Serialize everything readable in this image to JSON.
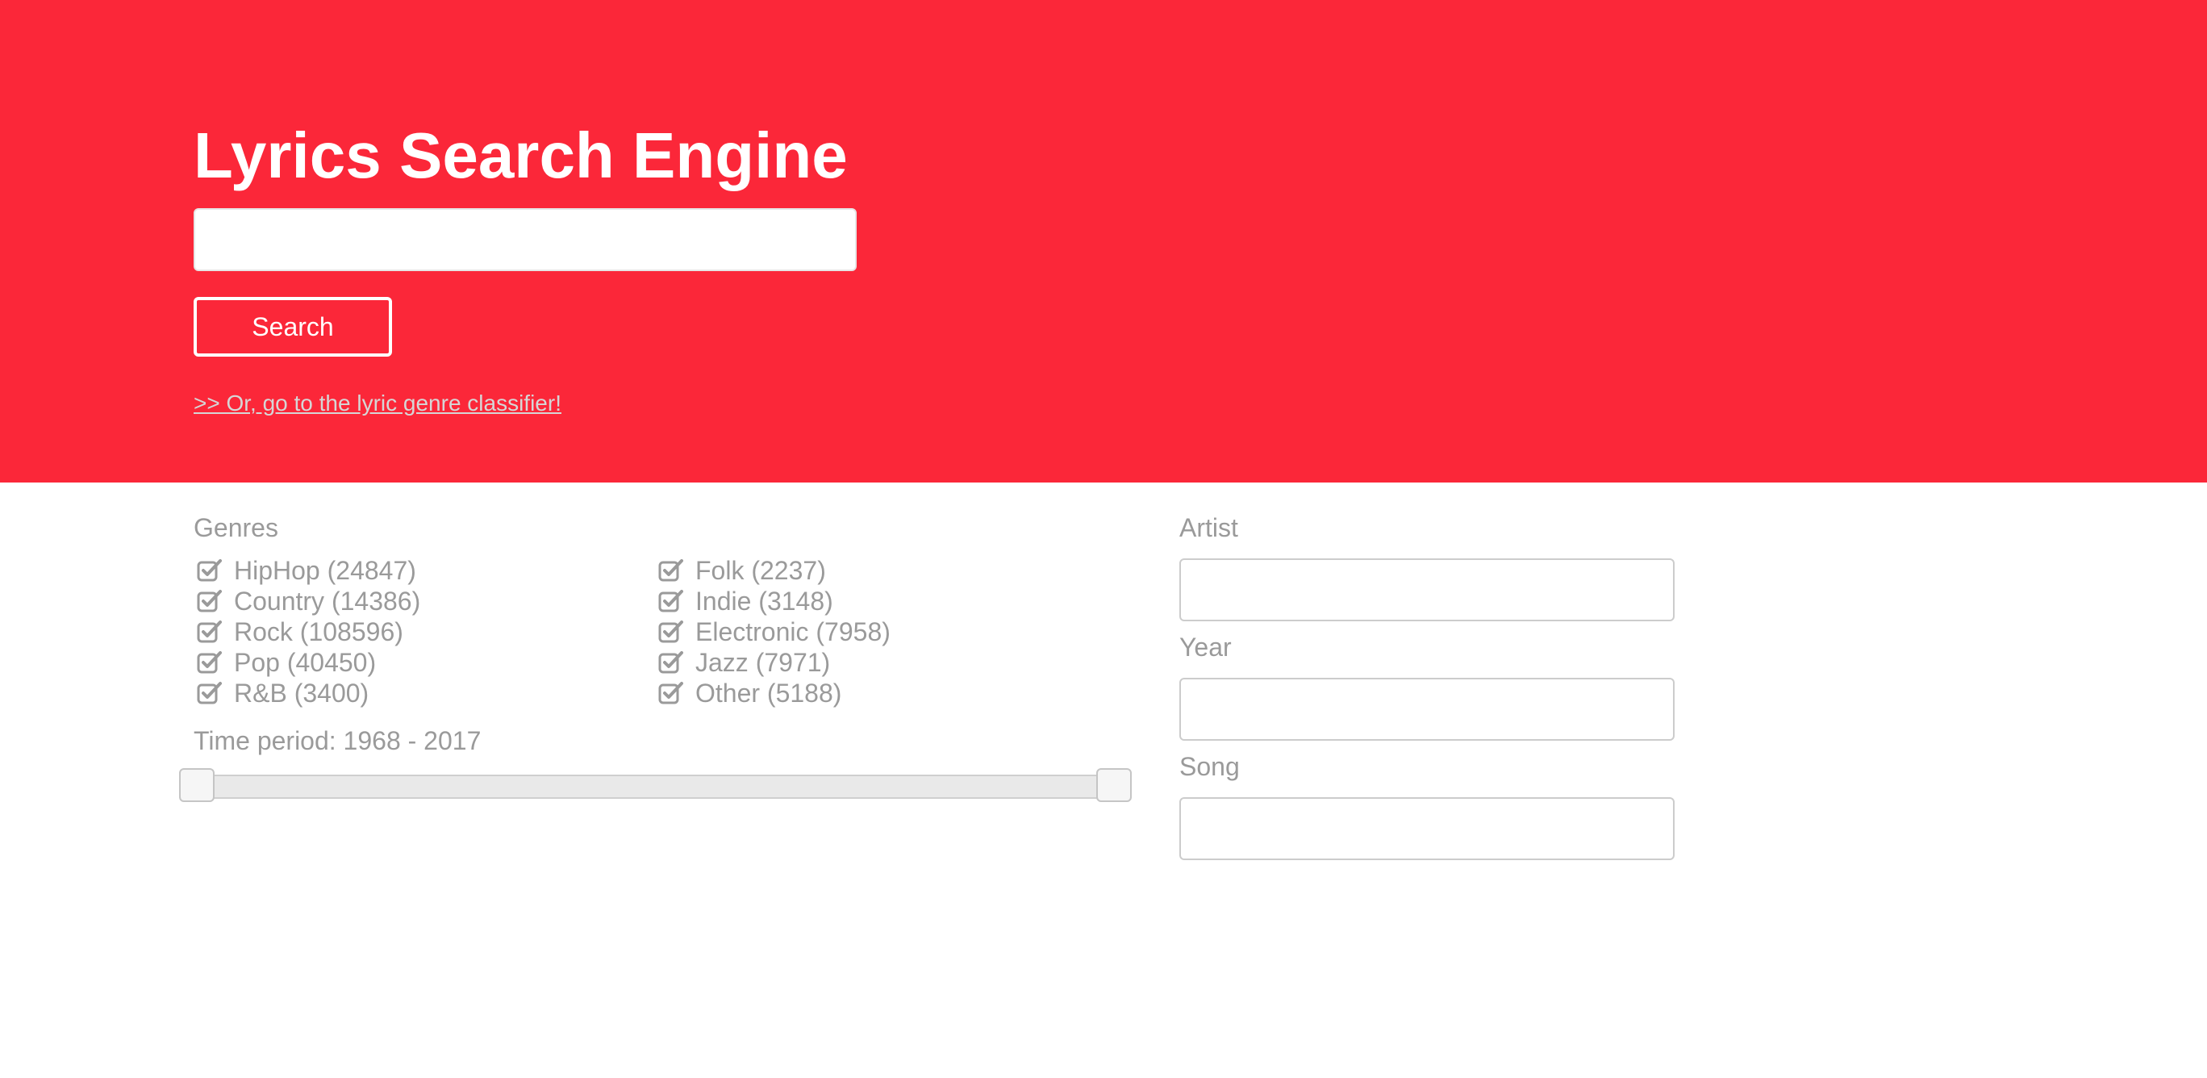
{
  "header": {
    "title": "Lyrics Search Engine",
    "search_placeholder": "",
    "search_value": "",
    "search_button_label": "Search",
    "classifier_link": ">> Or, go to the lyric genre classifier!"
  },
  "filters": {
    "genres_label": "Genres",
    "genres": [
      {
        "label": "HipHop (24847)",
        "checked": true
      },
      {
        "label": "Country (14386)",
        "checked": true
      },
      {
        "label": "Rock (108596)",
        "checked": true
      },
      {
        "label": "Pop (40450)",
        "checked": true
      },
      {
        "label": "R&B (3400)",
        "checked": true
      },
      {
        "label": "Folk (2237)",
        "checked": true
      },
      {
        "label": "Indie (3148)",
        "checked": true
      },
      {
        "label": "Electronic (7958)",
        "checked": true
      },
      {
        "label": "Jazz (7971)",
        "checked": true
      },
      {
        "label": "Other (5188)",
        "checked": true
      }
    ],
    "time_period_label": "Time period: 1968 - 2017",
    "time_period_range": [
      1968,
      2017
    ],
    "artist_label": "Artist",
    "artist_value": "",
    "year_label": "Year",
    "year_value": "",
    "song_label": "Song",
    "song_value": ""
  },
  "colors": {
    "accent": "#fb2739",
    "muted_text": "#9a9a9a"
  },
  "icons": {
    "checkbox": "checkbox-checked-icon"
  }
}
